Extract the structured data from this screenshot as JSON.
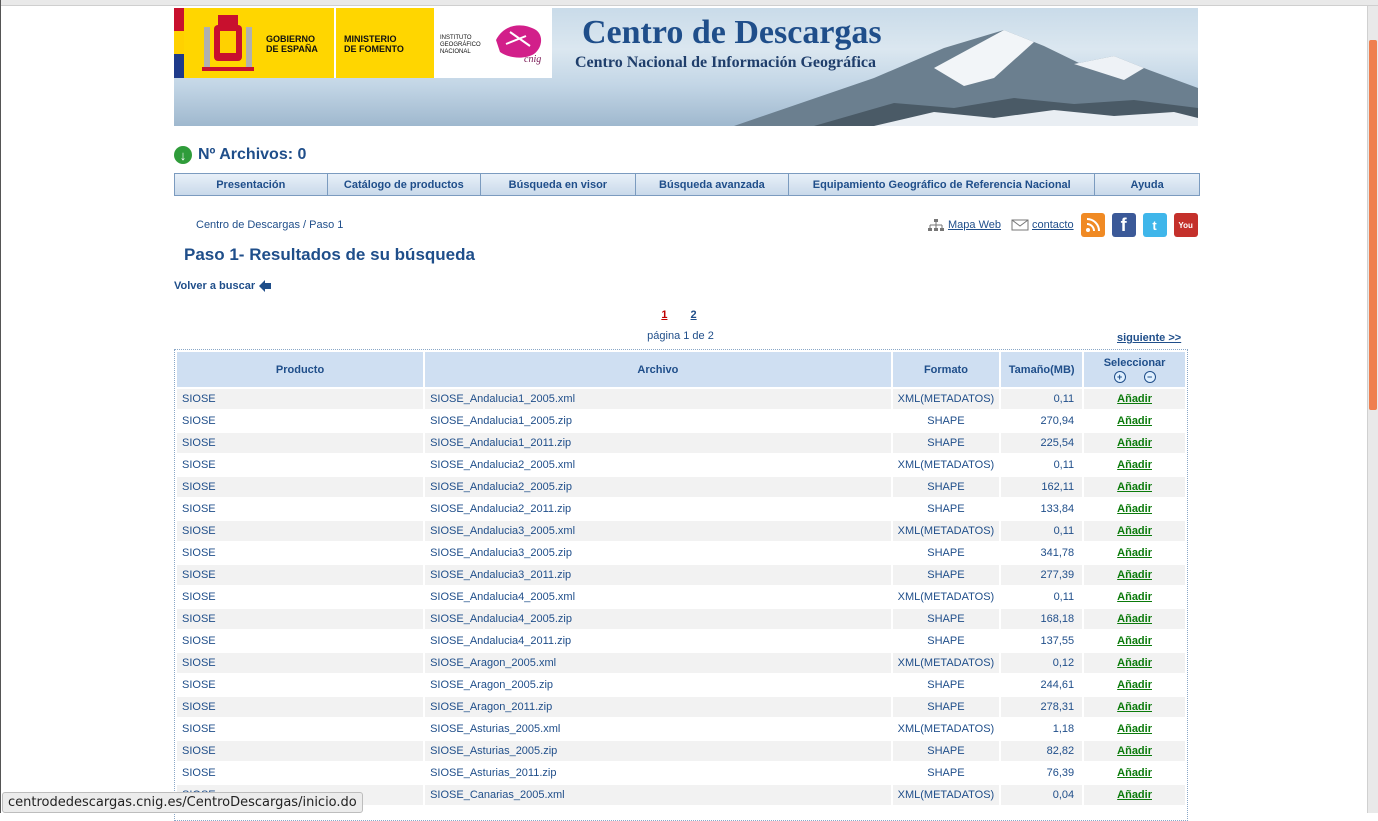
{
  "header": {
    "title": "Centro de Descargas",
    "subtitle": "Centro Nacional de Información Geográfica",
    "logo_gobierno": "GOBIERNO\nDE ESPAÑA",
    "logo_ministerio": "MINISTERIO\nDE FOMENTO",
    "logo_ign": "INSTITUTO\nGEOGRÁFICO\nNACIONAL",
    "logo_cnig": "cnig"
  },
  "files_count_label": "Nº Archivos: 0",
  "menu": [
    "Presentación",
    "Catálogo de productos",
    "Búsqueda en visor",
    "Búsqueda avanzada",
    "Equipamiento Geográfico de Referencia Nacional",
    "Ayuda"
  ],
  "breadcrumb": {
    "home": "Centro de Descargas",
    "separator": "/",
    "current": "Paso 1"
  },
  "toolbar": {
    "mapa_web": "Mapa Web",
    "contacto": "contacto"
  },
  "page_title": "Paso 1- Resultados de su búsqueda",
  "back_link": "Volver a buscar",
  "pagination": {
    "page1": "1",
    "page2": "2",
    "info": "página 1 de 2",
    "next": "siguiente >>"
  },
  "table": {
    "headers": {
      "producto": "Producto",
      "archivo": "Archivo",
      "formato": "Formato",
      "tamano": "Tamaño(MB)",
      "seleccionar": "Seleccionar"
    },
    "add_label": "Añadir",
    "rows": [
      {
        "producto": "SIOSE",
        "archivo": "SIOSE_Andalucia1_2005.xml",
        "formato": "XML(METADATOS)",
        "tamano": "0,11"
      },
      {
        "producto": "SIOSE",
        "archivo": "SIOSE_Andalucia1_2005.zip",
        "formato": "SHAPE",
        "tamano": "270,94"
      },
      {
        "producto": "SIOSE",
        "archivo": "SIOSE_Andalucia1_2011.zip",
        "formato": "SHAPE",
        "tamano": "225,54"
      },
      {
        "producto": "SIOSE",
        "archivo": "SIOSE_Andalucia2_2005.xml",
        "formato": "XML(METADATOS)",
        "tamano": "0,11"
      },
      {
        "producto": "SIOSE",
        "archivo": "SIOSE_Andalucia2_2005.zip",
        "formato": "SHAPE",
        "tamano": "162,11"
      },
      {
        "producto": "SIOSE",
        "archivo": "SIOSE_Andalucia2_2011.zip",
        "formato": "SHAPE",
        "tamano": "133,84"
      },
      {
        "producto": "SIOSE",
        "archivo": "SIOSE_Andalucia3_2005.xml",
        "formato": "XML(METADATOS)",
        "tamano": "0,11"
      },
      {
        "producto": "SIOSE",
        "archivo": "SIOSE_Andalucia3_2005.zip",
        "formato": "SHAPE",
        "tamano": "341,78"
      },
      {
        "producto": "SIOSE",
        "archivo": "SIOSE_Andalucia3_2011.zip",
        "formato": "SHAPE",
        "tamano": "277,39"
      },
      {
        "producto": "SIOSE",
        "archivo": "SIOSE_Andalucia4_2005.xml",
        "formato": "XML(METADATOS)",
        "tamano": "0,11"
      },
      {
        "producto": "SIOSE",
        "archivo": "SIOSE_Andalucia4_2005.zip",
        "formato": "SHAPE",
        "tamano": "168,18"
      },
      {
        "producto": "SIOSE",
        "archivo": "SIOSE_Andalucia4_2011.zip",
        "formato": "SHAPE",
        "tamano": "137,55"
      },
      {
        "producto": "SIOSE",
        "archivo": "SIOSE_Aragon_2005.xml",
        "formato": "XML(METADATOS)",
        "tamano": "0,12"
      },
      {
        "producto": "SIOSE",
        "archivo": "SIOSE_Aragon_2005.zip",
        "formato": "SHAPE",
        "tamano": "244,61"
      },
      {
        "producto": "SIOSE",
        "archivo": "SIOSE_Aragon_2011.zip",
        "formato": "SHAPE",
        "tamano": "278,31"
      },
      {
        "producto": "SIOSE",
        "archivo": "SIOSE_Asturias_2005.xml",
        "formato": "XML(METADATOS)",
        "tamano": "1,18"
      },
      {
        "producto": "SIOSE",
        "archivo": "SIOSE_Asturias_2005.zip",
        "formato": "SHAPE",
        "tamano": "82,82"
      },
      {
        "producto": "SIOSE",
        "archivo": "SIOSE_Asturias_2011.zip",
        "formato": "SHAPE",
        "tamano": "76,39"
      },
      {
        "producto": "SIOSE",
        "archivo": "SIOSE_Canarias_2005.xml",
        "formato": "XML(METADATOS)",
        "tamano": "0,04"
      }
    ]
  },
  "status_bar": "centrodedescargas.cnig.es/CentroDescargas/inicio.do",
  "colors": {
    "brand_blue": "#1f4e8a",
    "add_green": "#0a7a0a",
    "header_cell": "#cfdff2",
    "gov_yellow": "#ffd600"
  }
}
